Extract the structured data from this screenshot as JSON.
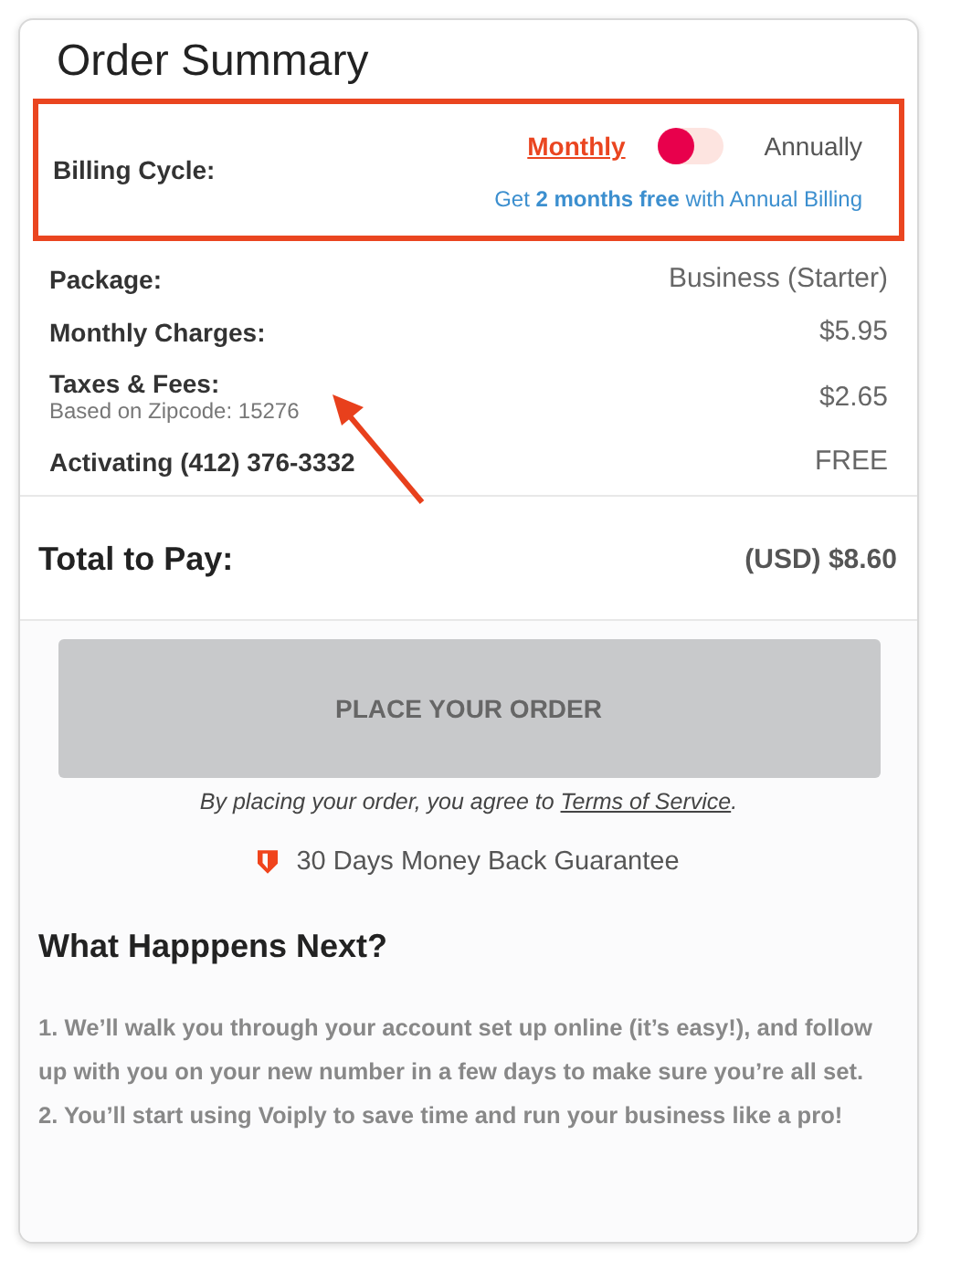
{
  "title": "Order Summary",
  "billing": {
    "label": "Billing Cycle:",
    "options": [
      {
        "label": "Monthly",
        "selected": true
      },
      {
        "label": "Annually",
        "selected": false
      }
    ],
    "toggle_on": false,
    "promo": "Get **2 months free** with Annual Billing",
    "highlighted": true
  },
  "lines": [
    {
      "label": "Package:",
      "value": "Business (Starter)"
    },
    {
      "label": "Monthly Charges:",
      "value": "$5.95"
    },
    {
      "label": "Taxes & Fees:",
      "note": "Based on Zipcode: 15276",
      "value": "$2.65"
    },
    {
      "label": "Activating (412) 376-3332",
      "value": "FREE"
    }
  ],
  "total": {
    "label": "Total to Pay:",
    "value": "(USD) $8.60"
  },
  "order_button": {
    "label": "PLACE YOUR ORDER",
    "disabled": true
  },
  "agreement": {
    "text": "By placing your order, you agree to ",
    "link": "Terms of Service",
    "end": "."
  },
  "guarantee": "30 Days Money Back Guarantee",
  "next": {
    "title": "What Happpens Next?",
    "steps": [
      "1. We’ll walk you through your account set up online (it’s easy!), and follow up with you on your new number in a few days to make sure you’re all set.",
      "2. You’ll start using Voiply to save time and run your business like a pro!"
    ]
  },
  "annotation_arrow": true
}
